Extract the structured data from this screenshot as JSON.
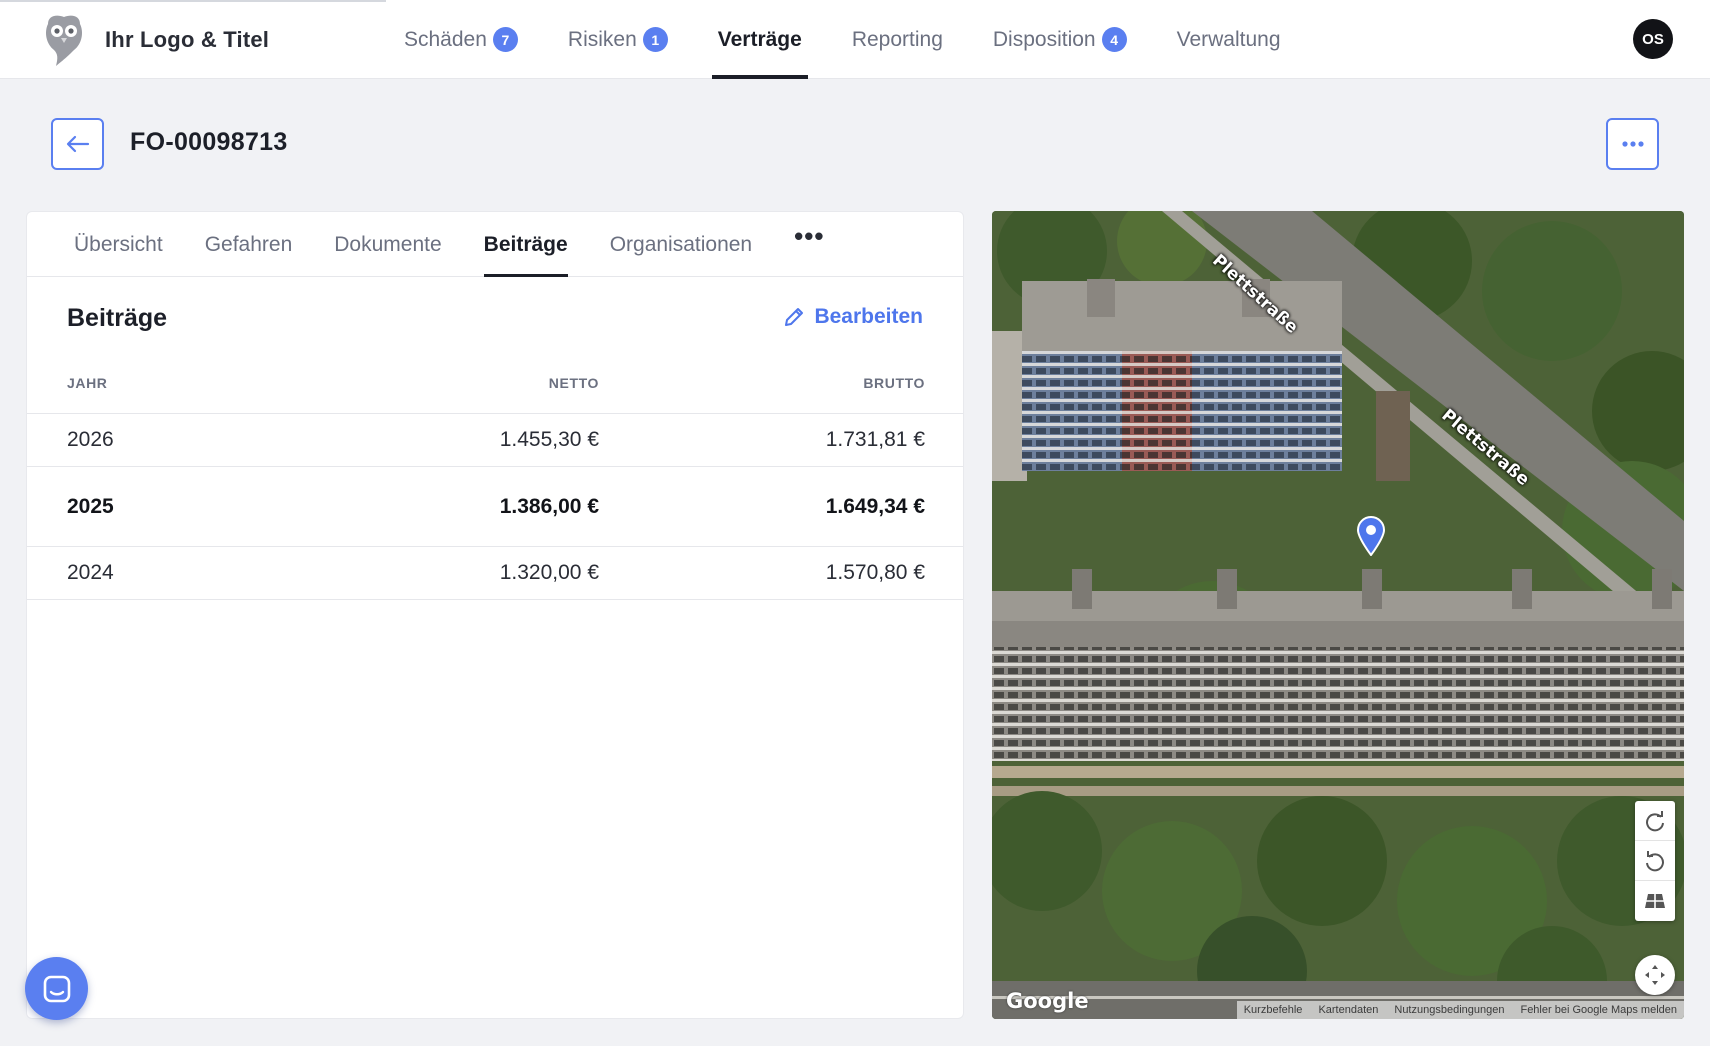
{
  "brand": {
    "title": "Ihr Logo & Titel"
  },
  "nav": {
    "items": [
      {
        "label": "Schäden",
        "badge": "7"
      },
      {
        "label": "Risiken",
        "badge": "1"
      },
      {
        "label": "Verträge",
        "badge": null,
        "active": true
      },
      {
        "label": "Reporting",
        "badge": null
      },
      {
        "label": "Disposition",
        "badge": "4"
      },
      {
        "label": "Verwaltung",
        "badge": null
      }
    ]
  },
  "user": {
    "initials": "OS"
  },
  "page": {
    "title": "FO-00098713"
  },
  "tabs": [
    {
      "label": "Übersicht"
    },
    {
      "label": "Gefahren"
    },
    {
      "label": "Dokumente"
    },
    {
      "label": "Beiträge",
      "active": true
    },
    {
      "label": "Organisationen"
    },
    {
      "label": "•••"
    }
  ],
  "section": {
    "title": "Beiträge",
    "edit_label": "Bearbeiten"
  },
  "table": {
    "headers": {
      "year": "JAHR",
      "netto": "NETTO",
      "brutto": "BRUTTO"
    },
    "rows": [
      {
        "year": "2026",
        "netto": "1.455,30 €",
        "brutto": "1.731,81 €"
      },
      {
        "year": "2025",
        "netto": "1.386,00 €",
        "brutto": "1.649,34 €",
        "highlight": true
      },
      {
        "year": "2024",
        "netto": "1.320,00 €",
        "brutto": "1.570,80 €"
      }
    ]
  },
  "map": {
    "streets": [
      "Plettstraße",
      "Plettstraße"
    ],
    "attribution": [
      "Kurzbefehle",
      "Kartendaten",
      "Nutzungsbedingungen",
      "Fehler bei Google Maps melden"
    ],
    "logo": "Google",
    "marker_color": "#4e76ec"
  },
  "colors": {
    "accent": "#5a7ff0",
    "text": "#1c1f28",
    "muted": "#6b7080"
  }
}
